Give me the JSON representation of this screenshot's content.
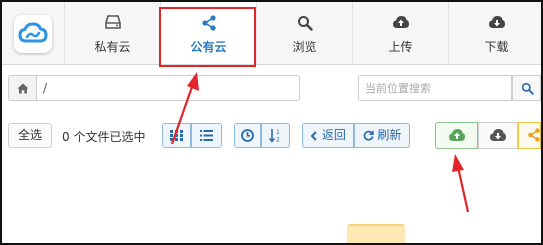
{
  "nav": {
    "items": [
      {
        "label": "私有云",
        "icon": "drive-icon"
      },
      {
        "label": "公有云",
        "icon": "share-icon",
        "active": true
      },
      {
        "label": "浏览",
        "icon": "search-icon"
      },
      {
        "label": "上传",
        "icon": "cloud-upload-icon"
      },
      {
        "label": "下载",
        "icon": "cloud-download-icon"
      }
    ]
  },
  "path": {
    "value": "/"
  },
  "search": {
    "placeholder": "当前位置搜索"
  },
  "toolbar": {
    "select_all": "全选",
    "selected_status": "0 个文件已选中",
    "back": "返回",
    "refresh": "刷新"
  },
  "colors": {
    "accent": "#2a7bc1",
    "highlight": "#e0262a",
    "upload_green": "#5aa55a",
    "share_orange": "#f0a020"
  }
}
